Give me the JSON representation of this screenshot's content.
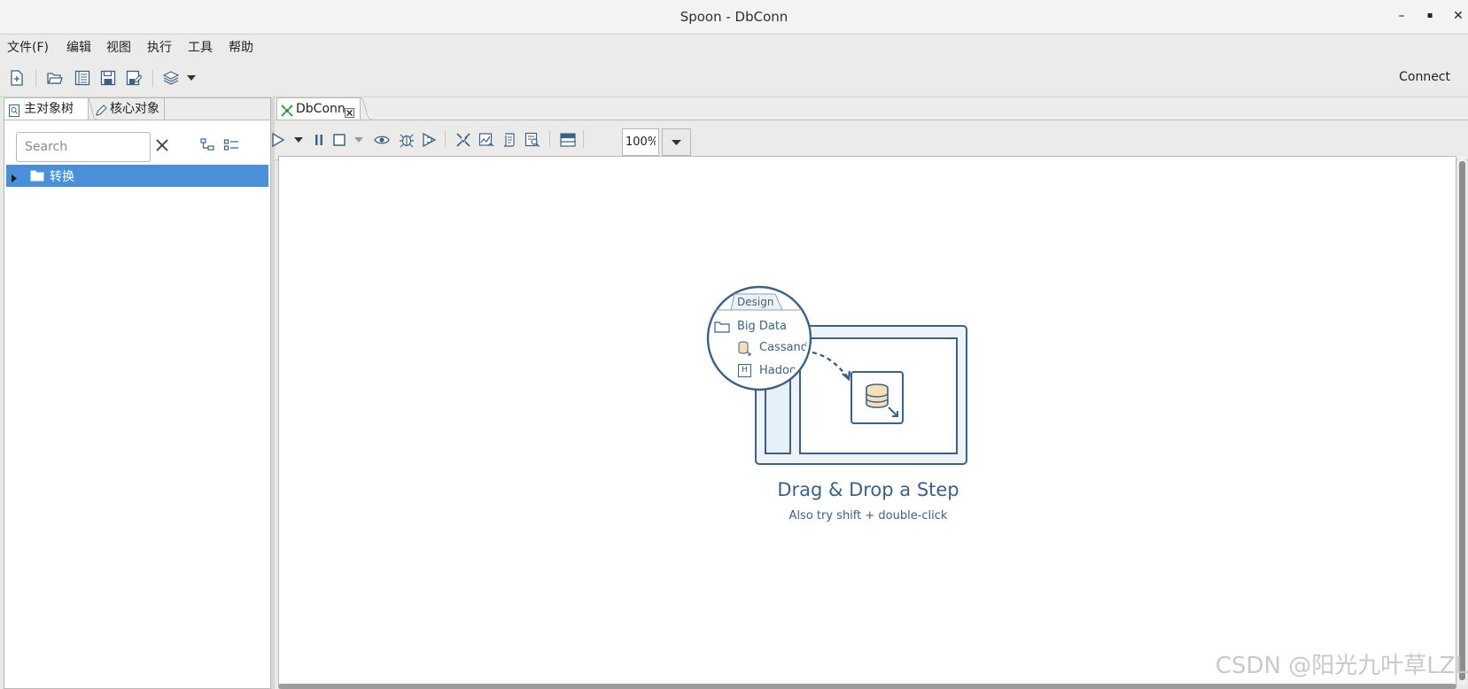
{
  "window": {
    "title": "Spoon - DbConn",
    "minimize": "–",
    "maximize": "▪",
    "close": "✕"
  },
  "menu": [
    "文件(F)",
    "编辑",
    "视图",
    "执行",
    "工具",
    "帮助"
  ],
  "toolbar": {
    "connect_label": "Connect",
    "icons": [
      "new-file-icon",
      "open-file-icon",
      "explore-repository-icon",
      "save-icon",
      "save-as-icon",
      "layers-icon",
      "dropdown-arrow-icon"
    ]
  },
  "left_panel": {
    "tabs": [
      "主对象树",
      "核心对象"
    ],
    "search_placeholder": "Search",
    "tree": [
      {
        "label": "转换",
        "expanded": false,
        "selected": true
      }
    ]
  },
  "editor": {
    "tab_label": "DbConn",
    "zoom": "100%",
    "toolbar_icons": [
      "run-icon",
      "run-options-dropdown-icon",
      "pause-icon",
      "stop-icon",
      "stop-options-dropdown-icon",
      "preview-icon",
      "debug-icon",
      "replay-icon",
      "verify-icon",
      "impact-icon",
      "sql-icon",
      "explore-db-icon",
      "show-results-icon"
    ]
  },
  "canvas": {
    "illustration": {
      "tab_label": "Design",
      "folder_label": "Big Data",
      "item_1": "Cassandr",
      "item_2": "Hadoo",
      "hadoop_badge": "H"
    },
    "headline": "Drag & Drop a Step",
    "subtext": "Also try shift + double-click"
  },
  "watermark": "CSDN @阳光九叶草LZL",
  "colors": {
    "selection": "#4a90d9",
    "illustration_stroke": "#3d6184",
    "tab_icon_green": "#3c9a3c"
  }
}
